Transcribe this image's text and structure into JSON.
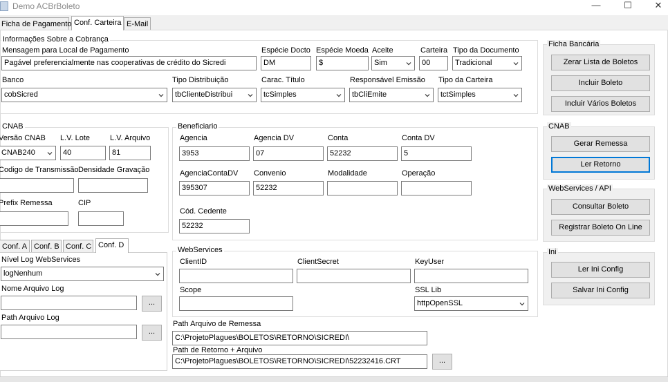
{
  "window": {
    "title": "Demo ACBrBoleto",
    "minimize": "—",
    "maximize": "☐",
    "close": "✕"
  },
  "tabs": [
    "Ficha de Pagamento",
    "Conf. Carteira",
    "E-Mail"
  ],
  "cobranca": {
    "title": "Informações Sobre a Cobrança",
    "mensagem_label": "Mensagem para Local de Pagamento",
    "mensagem_value": "Pagável preferencialmente nas cooperativas de crédito do Sicredi",
    "especie_doc_label": "Espécie Docto",
    "especie_doc_value": "DM",
    "especie_moeda_label": "Espécie Moeda",
    "especie_moeda_value": "$",
    "aceite_label": "Aceite",
    "aceite_value": "Sim",
    "carteira_label": "Carteira",
    "carteira_value": "00",
    "tipo_doc_label": "Tipo da Documento",
    "tipo_doc_value": "Tradicional",
    "banco_label": "Banco",
    "banco_value": "cobSicred",
    "tipo_dist_label": "Tipo Distribuição",
    "tipo_dist_value": "tbClienteDistribui",
    "carac_label": "Carac. Título",
    "carac_value": "tcSimples",
    "resp_label": "Responsável Emissão",
    "resp_value": "tbCliEmite",
    "tipo_carteira_label": "Tipo da Carteira",
    "tipo_carteira_value": "tctSimples"
  },
  "cnab": {
    "title": "CNAB",
    "versao_label": "Versão CNAB",
    "versao_value": "CNAB240",
    "lv_lote_label": "L.V. Lote",
    "lv_lote_value": "40",
    "lv_arquivo_label": "L.V. Arquivo",
    "lv_arquivo_value": "81",
    "codigo_label": "Codigo de Transmissão",
    "codigo_value": "",
    "densidade_label": "Densidade Gravação",
    "densidade_value": "",
    "prefix_label": "Prefix Remessa",
    "prefix_value": "",
    "cip_label": "CIP",
    "cip_value": ""
  },
  "beneficiario": {
    "title": "Beneficiario",
    "agencia_label": "Agencia",
    "agencia_value": "3953",
    "agencia_dv_label": "Agencia DV",
    "agencia_dv_value": "07",
    "conta_label": "Conta",
    "conta_value": "52232",
    "conta_dv_label": "Conta DV",
    "conta_dv_value": "5",
    "agencia_conta_dv_label": "AgenciaContaDV",
    "agencia_conta_dv_value": "395307",
    "convenio_label": "Convenio",
    "convenio_value": "52232",
    "modalidade_label": "Modalidade",
    "modalidade_value": "",
    "operacao_label": "Operação",
    "operacao_value": "",
    "cod_cedente_label": "Cód. Cedente",
    "cod_cedente_value": "52232"
  },
  "subtabs": [
    "Conf. A",
    "Conf. B",
    "Conf. C",
    "Conf. D"
  ],
  "confd": {
    "nivel_label": "Nível Log WebServices",
    "nivel_value": "logNenhum",
    "nome_label": "Nome Arquivo Log",
    "nome_value": "",
    "path_label": "Path Arquivo Log",
    "path_value": "",
    "dots": "..."
  },
  "webservices": {
    "title": "WebServices",
    "clientid_label": "ClientID",
    "clientid_value": "",
    "clientsecret_label": "ClientSecret",
    "clientsecret_value": "",
    "keyuser_label": "KeyUser",
    "keyuser_value": "",
    "scope_label": "Scope",
    "scope_value": "",
    "ssl_label": "SSL Lib",
    "ssl_value": "httpOpenSSL"
  },
  "paths": {
    "remessa_label": "Path Arquivo de Remessa",
    "remessa_value": "C:\\ProjetoPlagues\\BOLETOS\\RETORNO\\SICREDI\\",
    "retorno_label": "Path de Retorno + Arquivo",
    "retorno_value": "C:\\ProjetoPlagues\\BOLETOS\\RETORNO\\SICREDI\\52232416.CRT",
    "dots": "..."
  },
  "sidebar": {
    "ficha_title": "Ficha Bancária",
    "zerar": "Zerar Lista de Boletos",
    "incluir": "Incluir Boleto",
    "incluir_varios": "Incluir Vários Boletos",
    "cnab_title": "CNAB",
    "gerar": "Gerar Remessa",
    "ler_retorno": "Ler Retorno",
    "ws_title": "WebServices / API",
    "consultar": "Consultar Boleto",
    "registrar": "Registrar Boleto On Line",
    "ini_title": "Ini",
    "ler_ini": "Ler Ini Config",
    "salvar_ini": "Salvar Ini Config"
  }
}
